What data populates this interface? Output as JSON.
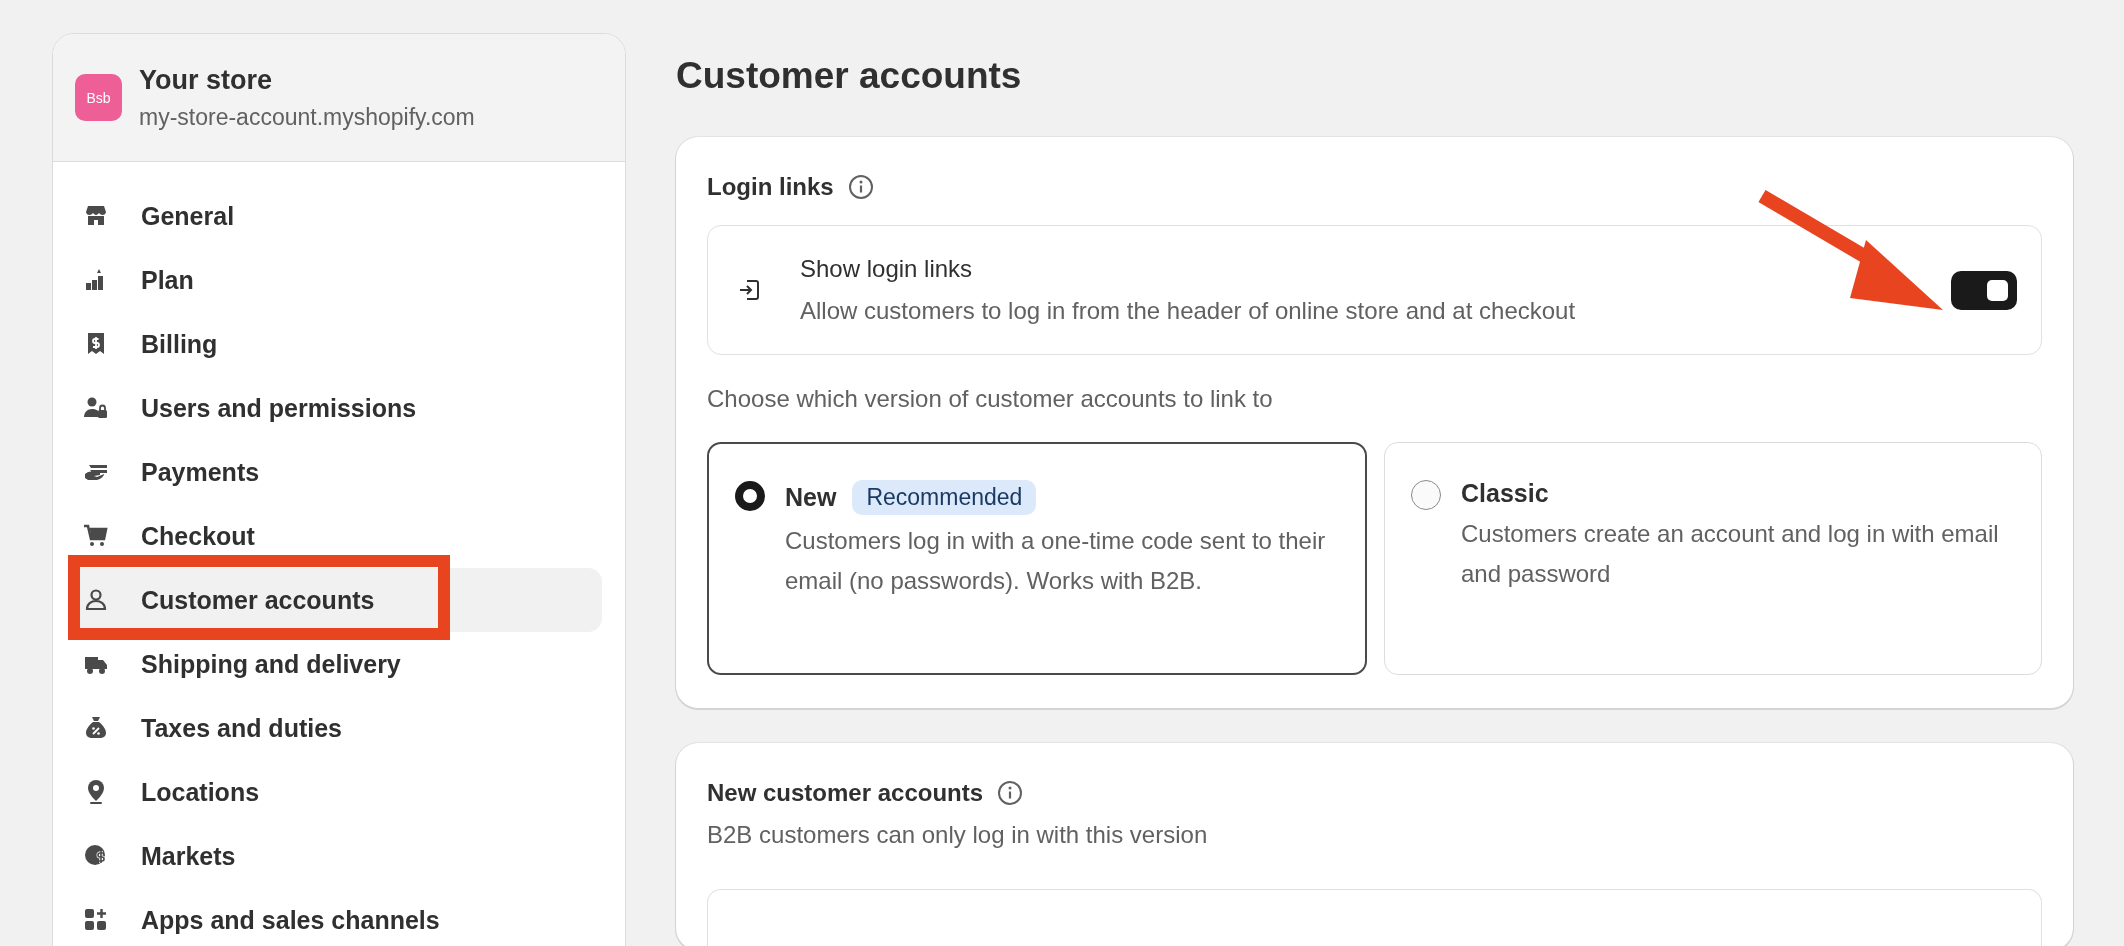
{
  "store": {
    "avatar": "Bsb",
    "name": "Your store",
    "domain": "my-store-account.myshopify.com"
  },
  "nav": [
    {
      "label": "General",
      "selected": false
    },
    {
      "label": "Plan",
      "selected": false
    },
    {
      "label": "Billing",
      "selected": false
    },
    {
      "label": "Users and permissions",
      "selected": false
    },
    {
      "label": "Payments",
      "selected": false
    },
    {
      "label": "Checkout",
      "selected": false
    },
    {
      "label": "Customer accounts",
      "selected": true
    },
    {
      "label": "Shipping and delivery",
      "selected": false
    },
    {
      "label": "Taxes and duties",
      "selected": false
    },
    {
      "label": "Locations",
      "selected": false
    },
    {
      "label": "Markets",
      "selected": false
    },
    {
      "label": "Apps and sales channels",
      "selected": false
    }
  ],
  "page_title": "Customer accounts",
  "login_links": {
    "title": "Login links",
    "setting": {
      "title": "Show login links",
      "description": "Allow customers to log in from the header of online store and at checkout",
      "on": true
    },
    "choose_label": "Choose which version of customer accounts to link to",
    "options": [
      {
        "title": "New",
        "badge": "Recommended",
        "description": "Customers log in with a one-time code sent to their email (no passwords). Works with B2B.",
        "selected": true
      },
      {
        "title": "Classic",
        "description": "Customers create an account and log in with email and password",
        "selected": false
      }
    ]
  },
  "new_accounts": {
    "title": "New customer accounts",
    "subtitle": "B2B customers can only log in with this version"
  }
}
